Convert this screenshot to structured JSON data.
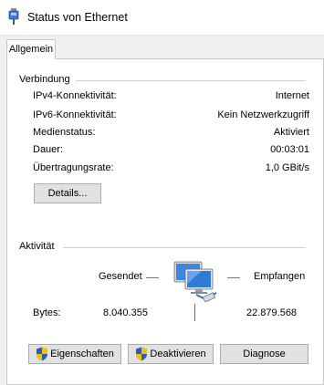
{
  "window": {
    "title": "Status von Ethernet"
  },
  "tabs": [
    {
      "label": "Allgemein",
      "active": true
    }
  ],
  "connection": {
    "heading": "Verbindung",
    "rows": [
      {
        "label": "IPv4-Konnektivität:",
        "value": "Internet"
      },
      {
        "label": "IPv6-Konnektivität:",
        "value": "Kein Netzwerkzugriff"
      },
      {
        "label": "Medienstatus:",
        "value": "Aktiviert"
      },
      {
        "label": "Dauer:",
        "value": "00:03:01"
      },
      {
        "label": "Übertragungsrate:",
        "value": "1,0 GBit/s"
      }
    ],
    "details_button": "Details..."
  },
  "activity": {
    "heading": "Aktivität",
    "sent_label": "Gesendet",
    "received_label": "Empfangen",
    "bytes_label": "Bytes:",
    "bytes_sent": "8.040.355",
    "bytes_received": "22.879.568",
    "icon": "network-computer-icon"
  },
  "buttons": {
    "properties": "Eigenschaften",
    "deactivate": "Deaktivieren",
    "diagnose": "Diagnose"
  },
  "colors": {
    "window_bg": "#f0f0f0",
    "panel_bg": "#ffffff",
    "button_bg": "#e1e1e1",
    "button_border": "#adadad",
    "shield_blue": "#2a5fb8",
    "shield_yellow": "#f2c200"
  }
}
